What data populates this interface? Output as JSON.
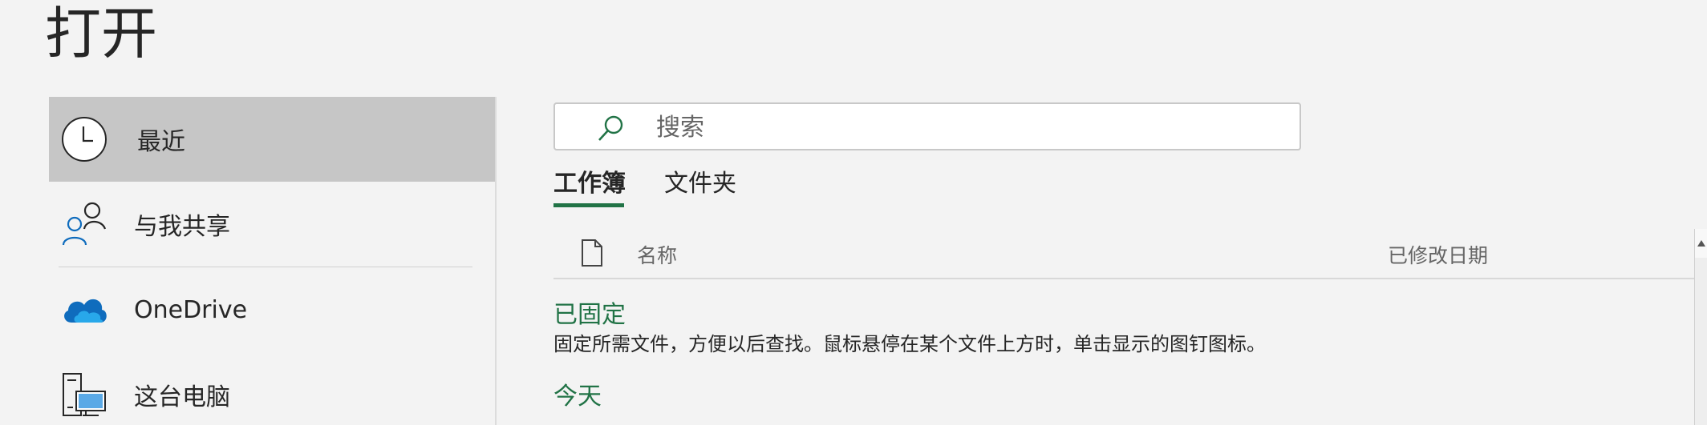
{
  "page": {
    "title": "打开"
  },
  "nav": {
    "items": [
      {
        "label": "最近",
        "icon": "clock-icon",
        "selected": true
      },
      {
        "label": "与我共享",
        "icon": "shared-people-icon",
        "selected": false
      },
      {
        "label": "OneDrive",
        "icon": "onedrive-cloud-icon",
        "selected": false
      },
      {
        "label": "这台电脑",
        "icon": "this-pc-icon",
        "selected": false
      }
    ]
  },
  "search": {
    "placeholder": "搜索",
    "value": ""
  },
  "tabs": [
    {
      "label": "工作簿",
      "active": true
    },
    {
      "label": "文件夹",
      "active": false
    }
  ],
  "list": {
    "columns": {
      "name": "名称",
      "modified": "已修改日期"
    },
    "sections": {
      "pinned": {
        "title": "已固定",
        "description": "固定所需文件，方便以后查找。鼠标悬停在某个文件上方时，单击显示的图钉图标。"
      },
      "today": {
        "title": "今天"
      }
    }
  },
  "colors": {
    "accent": "#217346",
    "selected_bg": "#c6c6c6",
    "background": "#f3f3f3",
    "onedrive_blue": "#0f6cbd"
  }
}
